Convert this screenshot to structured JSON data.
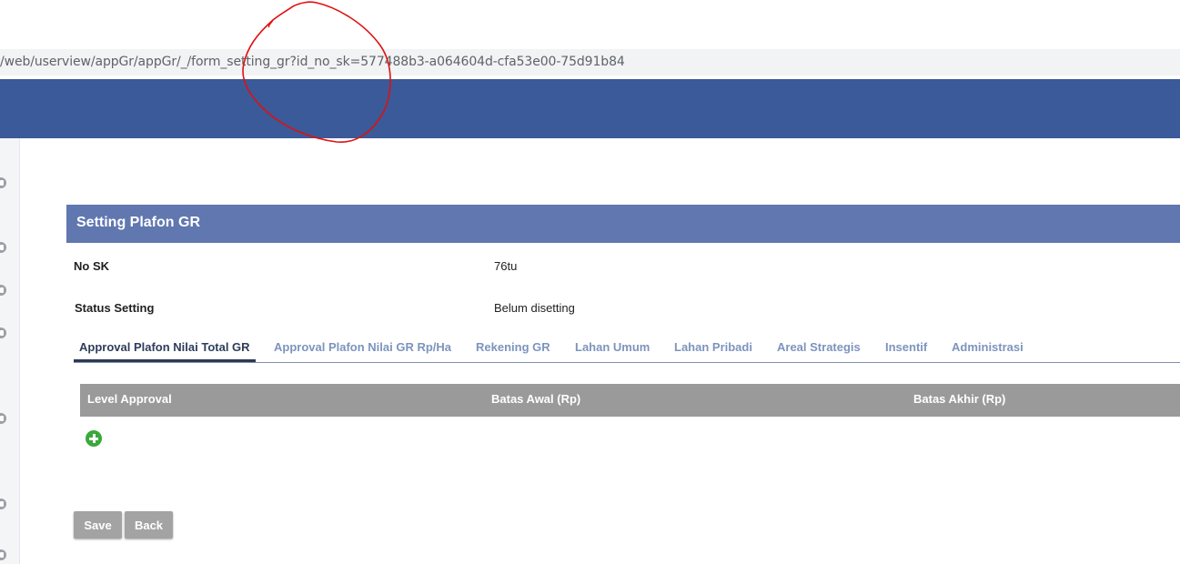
{
  "browser": {
    "url": "/web/userview/appGr/appGr/_/form_setting_gr?id_no_sk=577488b3-a064604d-cfa53e00-75d91b84"
  },
  "form": {
    "title": "Setting Plafon GR",
    "fields": [
      {
        "label": "No SK",
        "value": "76tu"
      },
      {
        "label": "Status Setting",
        "value": "Belum disetting"
      }
    ]
  },
  "tabs": [
    {
      "label": "Approval Plafon Nilai Total GR",
      "active": true
    },
    {
      "label": "Approval Plafon Nilai GR Rp/Ha",
      "active": false
    },
    {
      "label": "Rekening GR",
      "active": false
    },
    {
      "label": "Lahan Umum",
      "active": false
    },
    {
      "label": "Lahan Pribadi",
      "active": false
    },
    {
      "label": "Areal Strategis",
      "active": false
    },
    {
      "label": "Insentif",
      "active": false
    },
    {
      "label": "Administrasi",
      "active": false
    }
  ],
  "grid": {
    "columns": [
      "Level Approval",
      "Batas Awal (Rp)",
      "Batas Akhir (Rp)"
    ],
    "rows": [],
    "add_icon": "plus-circle-icon"
  },
  "actions": {
    "save_label": "Save",
    "back_label": "Back"
  },
  "colors": {
    "header": "#3a5a99",
    "panel_header": "#6077b0",
    "grid_header": "#9a9a9a",
    "add_icon": "#3aa83a",
    "annotation": "#e01010"
  }
}
